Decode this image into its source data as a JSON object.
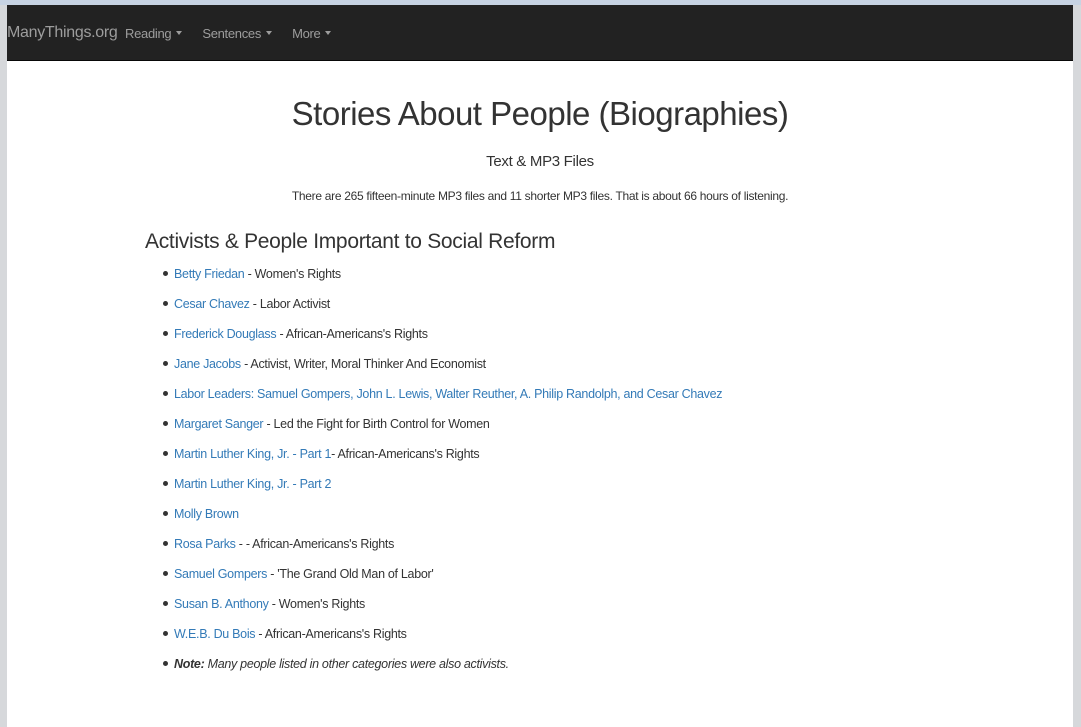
{
  "navbar": {
    "brand": "ManyThings.org",
    "menus": [
      {
        "label": "Reading"
      },
      {
        "label": "Sentences"
      },
      {
        "label": "More"
      }
    ]
  },
  "header": {
    "title": "Stories About People (Biographies)",
    "subtitle": "Text & MP3 Files",
    "summary": "There are 265 fifteen-minute MP3 files and 11 shorter MP3 files. That is about 66 hours of listening."
  },
  "section": {
    "heading": "Activists & People Important to Social Reform",
    "items": [
      {
        "link": "Betty Friedan",
        "desc": " - Women's Rights"
      },
      {
        "link": "Cesar Chavez",
        "desc": " - Labor Activist"
      },
      {
        "link": "Frederick Douglass",
        "desc": " - African-Americans's Rights"
      },
      {
        "link": "Jane Jacobs",
        "desc": " - Activist, Writer, Moral Thinker And Economist"
      },
      {
        "link": "Labor Leaders: Samuel Gompers, John L. Lewis, Walter Reuther, A. Philip Randolph, and Cesar Chavez",
        "desc": ""
      },
      {
        "link": "Margaret Sanger",
        "desc": " - Led the Fight for Birth Control for Women"
      },
      {
        "link": "Martin Luther King, Jr. - Part 1",
        "desc": "- African-Americans's Rights"
      },
      {
        "link": "Martin Luther King, Jr. - Part 2",
        "desc": ""
      },
      {
        "link": "Molly Brown",
        "desc": ""
      },
      {
        "link": "Rosa Parks",
        "desc": " - - African-Americans's Rights"
      },
      {
        "link": "Samuel Gompers",
        "desc": " - 'The Grand Old Man of Labor'"
      },
      {
        "link": "Susan B. Anthony",
        "desc": " - Women's Rights"
      },
      {
        "link": "W.E.B. Du Bois",
        "desc": " - African-Americans's Rights"
      }
    ],
    "note": {
      "label": "Note:",
      "text": " Many people listed in other categories were also activists."
    }
  }
}
